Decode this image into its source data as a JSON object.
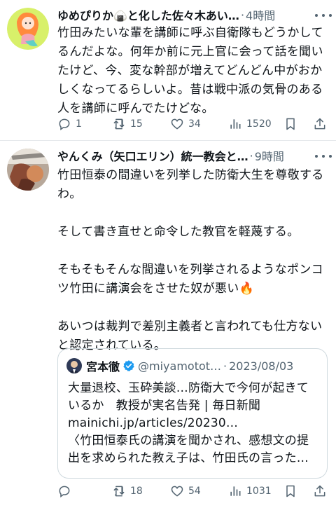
{
  "tweets": [
    {
      "name": "ゆめぴりか🍙と化した佐々木あい…",
      "separator": "·",
      "time": "4時間",
      "text": "竹田みたいな輩を講師に呼ぶ自衛隊もどうかしてるんだよな。何年か前に元上官に会って話を聞いたけど、今、変な幹部が増えてどんどん中がおかしくなってるらしいよ。昔は戦中派の気骨のある人を講師に呼んでたけどな。",
      "replies": "1",
      "retweets": "15",
      "likes": "34",
      "views": "1520"
    },
    {
      "name": "やんくみ（矢口エリン）統一教会と…",
      "separator": "·",
      "time": "9時間",
      "text": "竹田恒泰の間違いを列挙した防衛大生を尊敬するわ。\n\nそして書き直せと命令した教官を軽蔑する。\n\nそもそもそんな間違いを列挙されるようなポンコツ竹田に講演会をさせた奴が悪い🔥\n\nあいつは裁判で差別主義者と言われても仕方ないと認定されている。",
      "replies": "",
      "retweets": "18",
      "likes": "54",
      "views": "1031"
    }
  ],
  "quote": {
    "name": "宮本徹",
    "handle": "@miyamotot…",
    "separator": "·",
    "date": "2023/08/03",
    "text": "大量退校、玉砕美談…防衛大で今何が起きているか　教授が実名告発 | 毎日新聞\nmainichi.jp/articles/20230…\n〈竹田恒泰氏の講演を聞かされ、感想文の提出を求められた教え子は、竹田氏の言った…"
  },
  "icons": {
    "reply": "reply-icon",
    "retweet": "retweet-icon",
    "like": "heart-icon",
    "views": "views-icon",
    "bookmark": "bookmark-icon",
    "share": "share-icon",
    "more": "more-icon",
    "verified": "verified-badge-icon"
  },
  "colors": {
    "text": "#0f1419",
    "secondary": "#536471",
    "verified": "#1d9bf0",
    "border": "#cfd9de"
  }
}
